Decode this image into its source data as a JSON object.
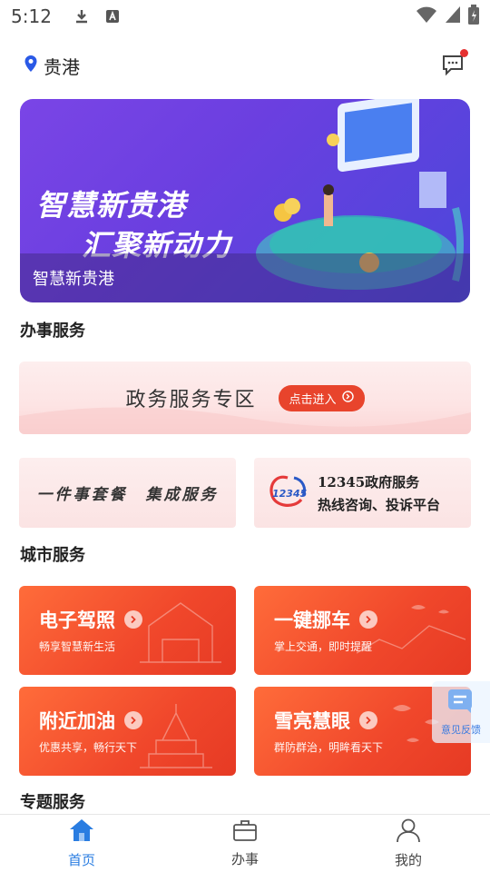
{
  "status_bar": {
    "time": "5:12"
  },
  "header": {
    "location": "贵港"
  },
  "banner": {
    "slogan_line1": "智慧新贵港",
    "slogan_line2": "汇聚新动力",
    "caption": "智慧新贵港"
  },
  "sections": {
    "affairs": "办事服务",
    "city": "城市服务",
    "topics": "专题服务"
  },
  "gov_zone": {
    "title": "政务服务专区",
    "enter_label": "点击进入"
  },
  "small_cards": {
    "one_thing": "一件事套餐　集成服务",
    "hotline_logo": "12345",
    "hotline_line1": "12345政府服务",
    "hotline_line2": "热线咨询、投诉平台"
  },
  "city_services": [
    {
      "title": "电子驾照",
      "subtitle": "畅享智慧新生活"
    },
    {
      "title": "一键挪车",
      "subtitle": "掌上交通，即时提醒"
    },
    {
      "title": "附近加油",
      "subtitle": "优惠共享，畅行天下"
    },
    {
      "title": "雪亮慧眼",
      "subtitle": "群防群治，明眸看天下"
    }
  ],
  "feedback": {
    "label": "意见反馈"
  },
  "tabbar": {
    "active": "home",
    "items": [
      {
        "id": "home",
        "label": "首页"
      },
      {
        "id": "affairs",
        "label": "办事"
      },
      {
        "id": "mine",
        "label": "我的"
      }
    ]
  },
  "colors": {
    "accent": "#2a7de1",
    "card_red": "#f0472b",
    "enter_button": "#e8442c"
  }
}
